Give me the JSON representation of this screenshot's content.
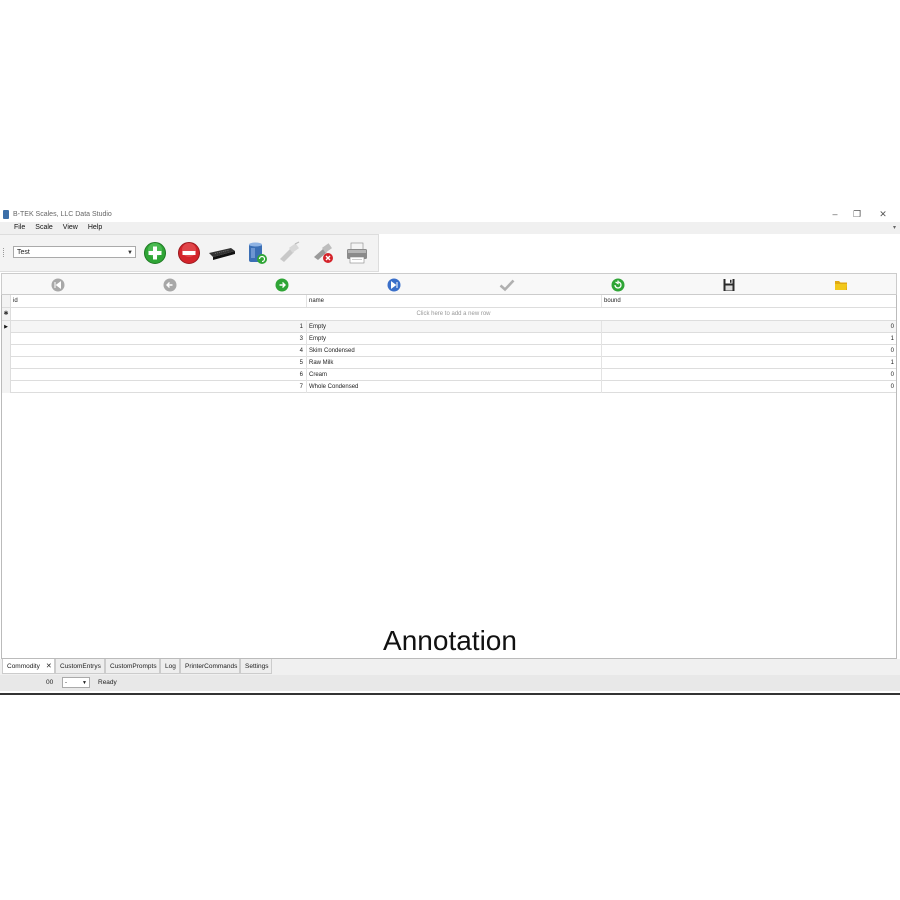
{
  "window": {
    "title": "B-TEK Scales, LLC Data Studio",
    "minimize": "–",
    "restore": "❐",
    "close": "✕"
  },
  "menu": {
    "items": [
      "File",
      "Scale",
      "View",
      "Help"
    ]
  },
  "toolbar": {
    "scale_select_value": "Test"
  },
  "grid": {
    "columns": [
      "id",
      "name",
      "bound"
    ],
    "new_row_text": "Click here to add a new row",
    "rows": [
      {
        "id": "1",
        "name": "Empty",
        "bound": "0"
      },
      {
        "id": "3",
        "name": "Empty",
        "bound": "1"
      },
      {
        "id": "4",
        "name": "Skim Condensed",
        "bound": "0"
      },
      {
        "id": "5",
        "name": "Raw Milk",
        "bound": "1"
      },
      {
        "id": "6",
        "name": "Cream",
        "bound": "0"
      },
      {
        "id": "7",
        "name": "Whole Condensed",
        "bound": "0"
      }
    ]
  },
  "overlay": {
    "annotation": "Annotation"
  },
  "tabs": [
    "Commodity",
    "CustomEntrys",
    "CustomPrompts",
    "Log",
    "PrinterCommands",
    "Settings"
  ],
  "status": {
    "code": "00",
    "select_value": "-",
    "text": "Ready"
  },
  "colors": {
    "add_green": "#2fa536",
    "remove_red": "#d4232a",
    "nav_blue": "#3a6fc9",
    "folder_yellow": "#f2c81c"
  }
}
